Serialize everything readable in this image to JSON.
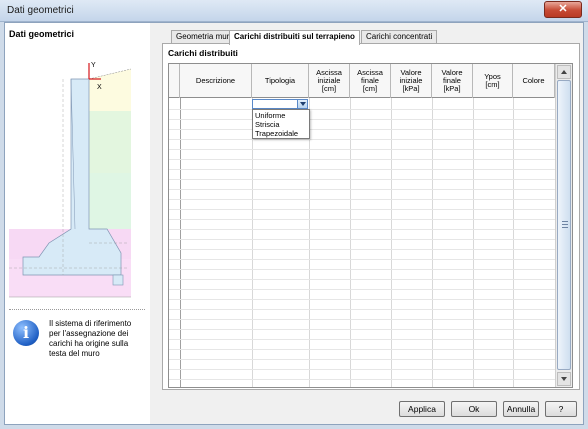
{
  "window": {
    "title": "Dati geometrici",
    "close_label": "✕"
  },
  "left_panel": {
    "title": "Dati geometrici",
    "axis_y": "Y",
    "axis_x": "X",
    "info_icon": "info-icon",
    "info_text": "Il sistema di riferimento per l'assegnazione dei carichi ha origine sulla testa del muro"
  },
  "tabs": [
    {
      "label": "Geometria muro",
      "active": false
    },
    {
      "label": "Carichi distribuiti sul terrapieno",
      "active": true
    },
    {
      "label": "Carichi concentrati",
      "active": false
    }
  ],
  "section": {
    "title": "Carichi distribuiti"
  },
  "table": {
    "columns": [
      "Descrizione",
      "Tipologia",
      "Ascissa\niniziale\n[cm]",
      "Ascissa\nfinale\n[cm]",
      "Valore\niniziale\n[kPa]",
      "Valore\nfinale\n[kPa]",
      "Ypos\n[cm]",
      "Colore"
    ],
    "rows": []
  },
  "tipologia_options": [
    "Uniforme",
    "Striscia",
    "Trapezoidale"
  ],
  "buttons": {
    "apply": "Applica",
    "ok": "Ok",
    "cancel": "Annulla",
    "help": "?"
  },
  "colors": {
    "frame": "#f0f0f0",
    "accent": "#5a89c8",
    "close": "#c64a35"
  }
}
